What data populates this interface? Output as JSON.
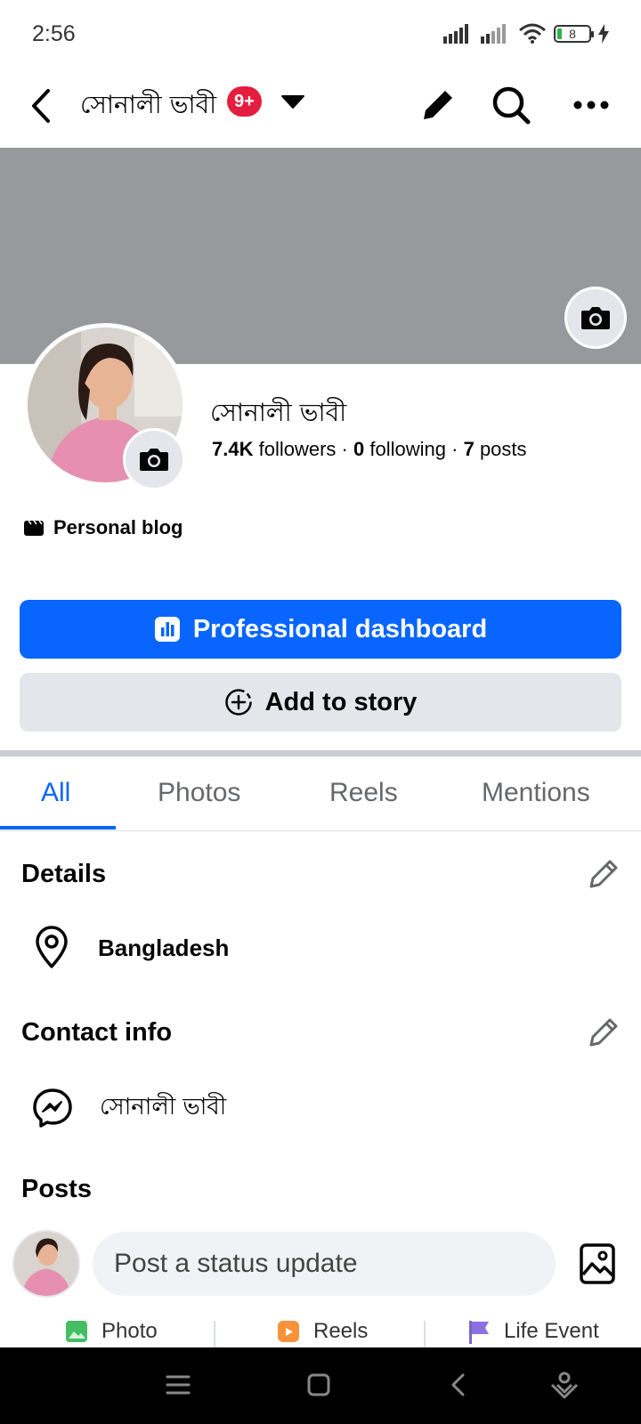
{
  "status_bar": {
    "time": "2:56",
    "battery": "8"
  },
  "top_bar": {
    "title": "সোনালী ভাবী",
    "badge": "9+"
  },
  "profile": {
    "name": "সোনালী ভাবী",
    "followers_count": "7.4K",
    "followers_label": "followers",
    "following_count": "0",
    "following_label": "following",
    "posts_count": "7",
    "posts_label": "posts",
    "category": "Personal blog"
  },
  "buttons": {
    "professional_dashboard": "Professional dashboard",
    "add_to_story": "Add to story"
  },
  "tabs": [
    {
      "label": "All",
      "active": true
    },
    {
      "label": "Photos",
      "active": false
    },
    {
      "label": "Reels",
      "active": false
    },
    {
      "label": "Mentions",
      "active": false
    }
  ],
  "details": {
    "title": "Details",
    "location": "Bangladesh"
  },
  "contact": {
    "title": "Contact info",
    "messenger": "সোনালী ভাবী"
  },
  "posts": {
    "title": "Posts",
    "composer_placeholder": "Post a status update",
    "actions": [
      {
        "label": "Photo",
        "icon": "photo-icon"
      },
      {
        "label": "Reels",
        "icon": "reels-icon"
      },
      {
        "label": "Life Event",
        "icon": "flag-icon"
      }
    ]
  },
  "colors": {
    "accent": "#0866ff",
    "badge": "#e41e3f",
    "cover": "#97999c"
  }
}
